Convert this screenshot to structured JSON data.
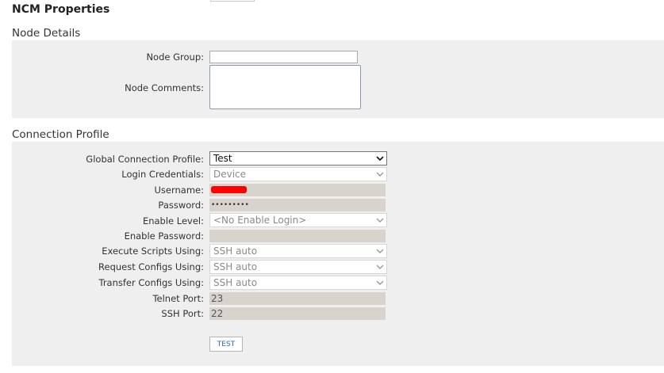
{
  "page_title": "NCM Properties",
  "node_details": {
    "title": "Node Details",
    "node_group_label": "Node Group:",
    "node_group_value": "",
    "node_comments_label": "Node Comments:",
    "node_comments_value": ""
  },
  "connection_profile": {
    "title": "Connection Profile",
    "fields": {
      "global_profile": {
        "label": "Global Connection Profile:",
        "value": "Test"
      },
      "login_credentials": {
        "label": "Login Credentials:",
        "value": "Device"
      },
      "username": {
        "label": "Username:",
        "value": ""
      },
      "password": {
        "label": "Password:",
        "value": "•••••••••"
      },
      "enable_level": {
        "label": "Enable Level:",
        "value": "<No Enable Login>"
      },
      "enable_password": {
        "label": "Enable Password:",
        "value": ""
      },
      "execute_scripts": {
        "label": "Execute Scripts Using:",
        "value": "SSH auto"
      },
      "request_configs": {
        "label": "Request Configs Using:",
        "value": "SSH auto"
      },
      "transfer_configs": {
        "label": "Transfer Configs Using:",
        "value": "SSH auto"
      },
      "telnet_port": {
        "label": "Telnet Port:",
        "value": "23"
      },
      "ssh_port": {
        "label": "SSH Port:",
        "value": "22"
      }
    },
    "test_button_label": "TEST"
  },
  "icons": {
    "dropdown": "chevron-down-icon"
  }
}
